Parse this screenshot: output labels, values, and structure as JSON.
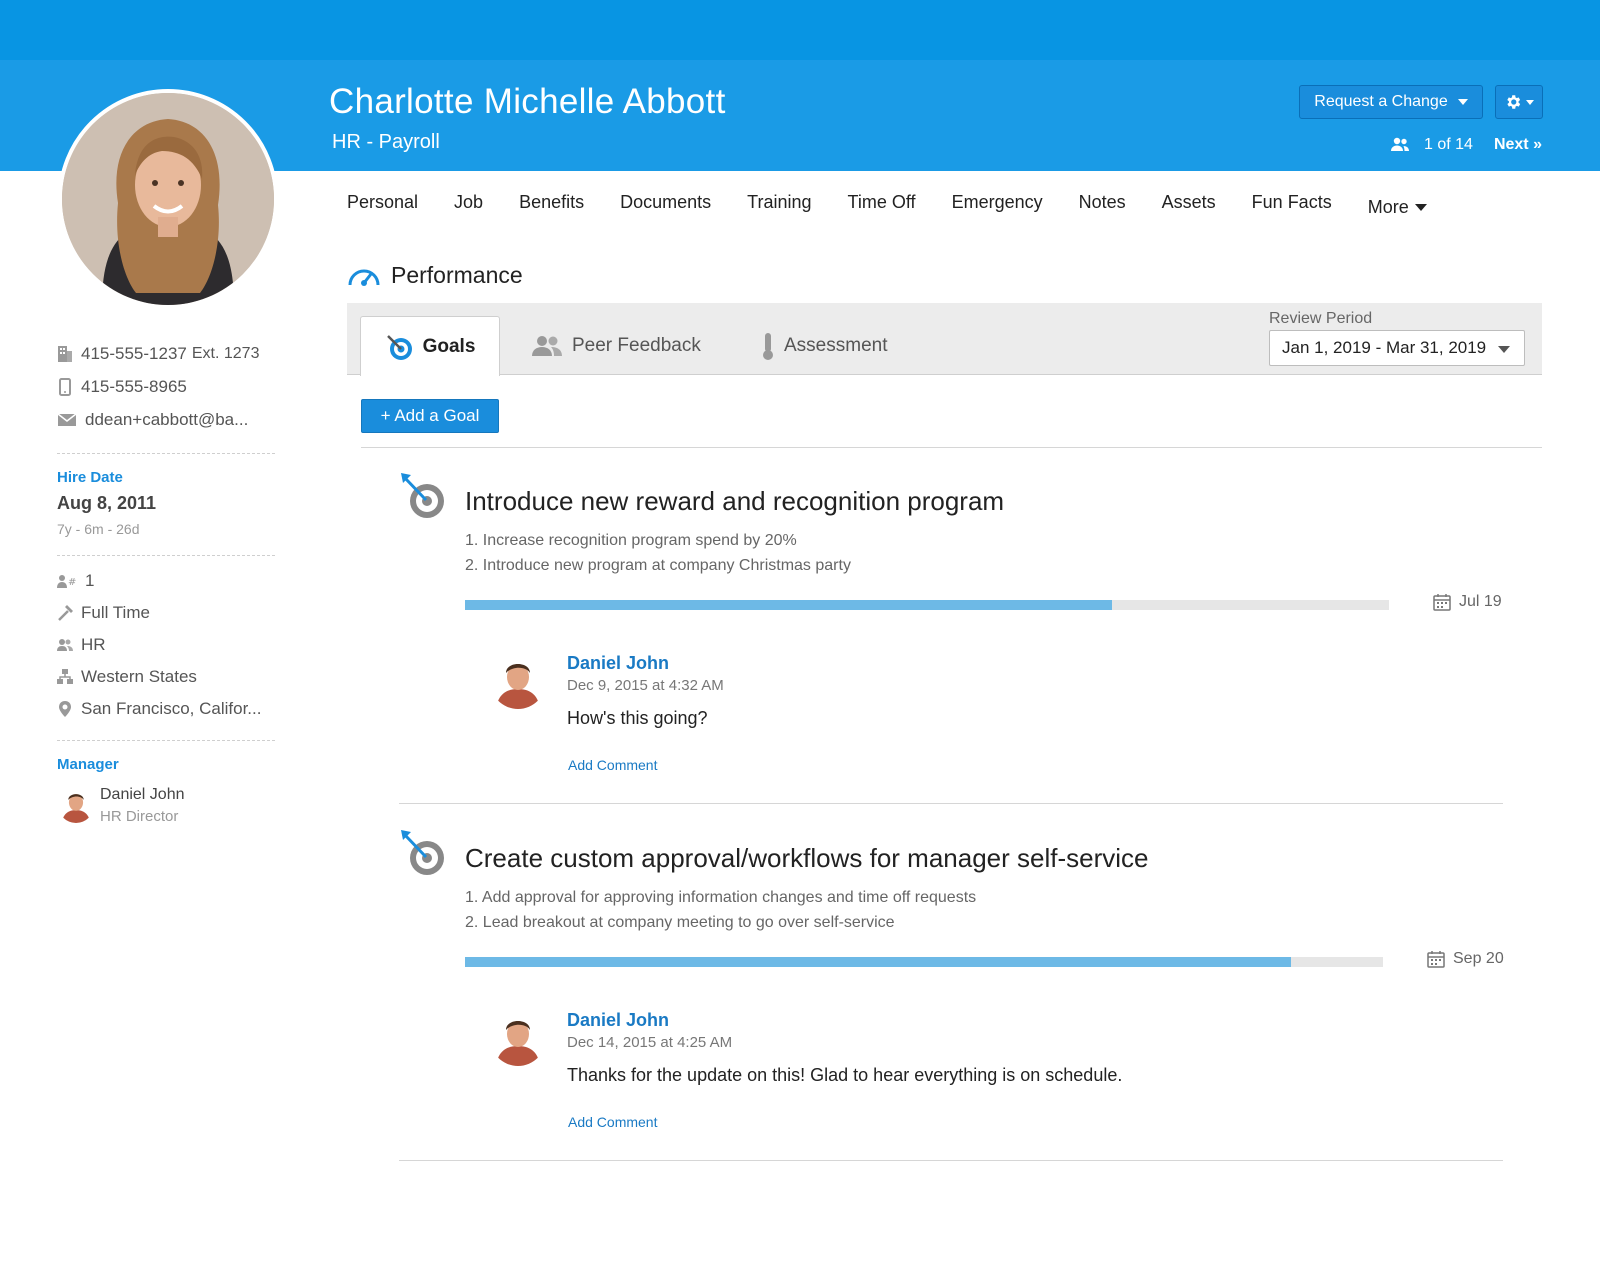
{
  "header": {
    "employee_name": "Charlotte Michelle Abbott",
    "department": "HR - Payroll",
    "request_change_label": "Request a Change",
    "pager_count": "1 of 14",
    "pager_next": "Next »"
  },
  "nav": {
    "items": [
      "Personal",
      "Job",
      "Benefits",
      "Documents",
      "Training",
      "Time Off",
      "Emergency",
      "Notes",
      "Assets",
      "Fun Facts",
      "More"
    ]
  },
  "section": {
    "title": "Performance"
  },
  "tabs": {
    "goals": "Goals",
    "peer_feedback": "Peer Feedback",
    "assessment": "Assessment",
    "review_period_label": "Review Period",
    "review_period_value": "Jan 1, 2019 - Mar 31, 2019"
  },
  "actions": {
    "add_goal": "+ Add a Goal"
  },
  "goals": [
    {
      "title": "Introduce new reward and recognition program",
      "lines": [
        "1. Increase recognition program spend by 20%",
        "2. Introduce new program at company Christmas party"
      ],
      "progress": 0.7,
      "due": "Jul 19",
      "comment": {
        "author": "Daniel John",
        "date": "Dec 9, 2015 at 4:32 AM",
        "text": "How's this going?",
        "add_label": "Add Comment"
      }
    },
    {
      "title": "Create custom approval/workflows for manager self-service",
      "lines": [
        "1. Add approval for approving information changes and time off requests",
        "2. Lead breakout at company meeting to go over self-service"
      ],
      "progress": 0.9,
      "due": "Sep 20",
      "comment": {
        "author": "Daniel John",
        "date": "Dec 14, 2015 at 4:25 AM",
        "text": "Thanks for the update on this!  Glad to hear everything is on schedule.",
        "add_label": "Add Comment"
      }
    }
  ],
  "sidebar": {
    "work_phone": "415-555-1237",
    "work_ext": "Ext. 1273",
    "mobile_phone": "415-555-8965",
    "email": "ddean+cabbott@ba...",
    "hire_date_label": "Hire Date",
    "hire_date": "Aug 8, 2011",
    "hire_duration": "7y - 6m - 26d",
    "employee_number": "1",
    "employment_type": "Full Time",
    "department": "HR",
    "division": "Western States",
    "location": "San Francisco, Califor...",
    "manager_label": "Manager",
    "manager_name": "Daniel John",
    "manager_title": "HR Director"
  },
  "colors": {
    "header_blue": "#1a9be6",
    "topbar_blue": "#0895e3",
    "accent": "#1a8ddc",
    "progress": "#6db9e6"
  }
}
